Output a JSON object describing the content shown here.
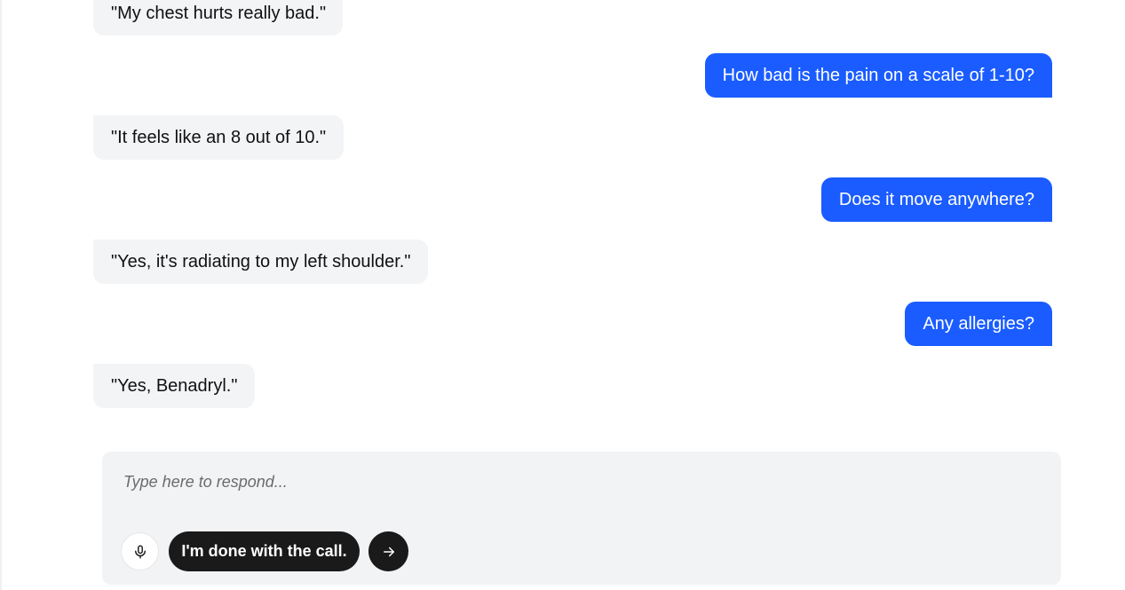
{
  "messages": [
    {
      "role": "patient",
      "text": "\"My chest hurts really bad.\""
    },
    {
      "role": "user",
      "text": "How bad is the pain on a scale of 1-10?"
    },
    {
      "role": "patient",
      "text": "\"It feels like an 8 out of 10.\""
    },
    {
      "role": "user",
      "text": "Does it move anywhere?"
    },
    {
      "role": "patient",
      "text": "\"Yes, it's radiating to my left shoulder.\""
    },
    {
      "role": "user",
      "text": "Any allergies?"
    },
    {
      "role": "patient",
      "text": "\"Yes, Benadryl.\""
    }
  ],
  "composer": {
    "placeholder": "Type here to respond...",
    "value": "",
    "mic_icon": "microphone-icon",
    "done_label": "I'm done with the call.",
    "send_icon": "arrow-right-icon"
  },
  "colors": {
    "outgoing_bubble": "#1a5cff",
    "incoming_bubble": "#f3f4f6",
    "composer_bg": "#f2f3f5",
    "dark_button": "#1a1a1a"
  }
}
